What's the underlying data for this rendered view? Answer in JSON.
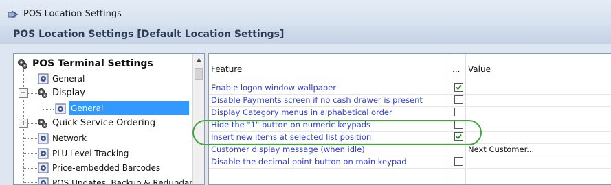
{
  "window": {
    "title": "POS Location Settings",
    "icon": "settings-window-icon"
  },
  "header": {
    "title": "POS Location Settings  [Default Location Settings]"
  },
  "tree": {
    "root": {
      "label": "POS Terminal Settings",
      "icon": "gears-icon"
    },
    "items": [
      {
        "label": "General",
        "icon": "gear-icon"
      },
      {
        "label": "Display",
        "icon": "gears-icon",
        "expander": "−"
      },
      {
        "label": "General",
        "icon": "gear-icon",
        "selected": true
      },
      {
        "label": "Quick Service Ordering",
        "icon": "gears-icon",
        "expander": "+"
      },
      {
        "label": "Network",
        "icon": "gear-icon"
      },
      {
        "label": "PLU Level Tracking",
        "icon": "gear-icon"
      },
      {
        "label": "Price-embedded Barcodes",
        "icon": "gear-icon"
      },
      {
        "label": "POS Updates, Backup & Redundancy",
        "icon": "gear-icon"
      }
    ]
  },
  "grid": {
    "columns": {
      "feature": "Feature",
      "flag": "...",
      "value": "Value"
    },
    "rows": [
      {
        "feature": "Enable logon window wallpaper",
        "checked": true,
        "value": ""
      },
      {
        "feature": "Disable Payments screen if no cash drawer is present",
        "checked": false,
        "value": ""
      },
      {
        "feature": "Display Category menus in alphabetical order",
        "checked": false,
        "value": ""
      },
      {
        "feature": "Hide the \"1\" button on numeric keypads",
        "checked": false,
        "value": ""
      },
      {
        "feature": "Insert new items at selected list position",
        "checked": true,
        "value": ""
      },
      {
        "feature": "Customer display message (when idle)",
        "checked": null,
        "value": "Next Customer..."
      },
      {
        "feature": "Disable the decimal point button on main keypad",
        "checked": false,
        "value": ""
      }
    ]
  },
  "colors": {
    "link": "#2f3fd0",
    "selection": "#3399ff",
    "highlight_ring": "#3ea73e",
    "check": "#1a8a1a"
  }
}
